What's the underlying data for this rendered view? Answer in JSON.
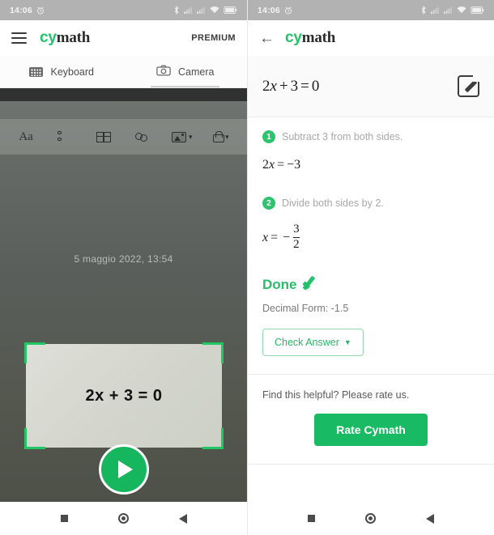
{
  "left": {
    "statusbar": {
      "time": "14:06",
      "icons": [
        "alarm-icon",
        "bluetooth-icon",
        "signal-icon",
        "signal-icon",
        "wifi-icon",
        "battery-icon"
      ]
    },
    "appbar": {
      "menu_icon": "hamburger-icon",
      "brand_cy": "cy",
      "brand_math": "math",
      "premium_label": "PREMIUM"
    },
    "tabs": [
      {
        "label": "Keyboard",
        "icon": "keyboard-icon",
        "active": false
      },
      {
        "label": "Camera",
        "icon": "camera-icon",
        "active": true
      }
    ],
    "camera": {
      "doc_toolbar": [
        "text-format-icon",
        "bullet-list-icon",
        "table-icon",
        "link-icon",
        "image-icon",
        "lock-icon"
      ],
      "date_text": "5 maggio 2022, 13:54",
      "scan_equation": "2x + 3 = 0",
      "frame_color": "#1ec862",
      "capture_label": "capture-button"
    },
    "navbar": [
      "recents-square-icon",
      "home-circle-icon",
      "back-triangle-icon"
    ]
  },
  "right": {
    "statusbar": {
      "time": "14:06",
      "icons": [
        "alarm-icon",
        "bluetooth-icon",
        "signal-icon",
        "signal-icon",
        "wifi-icon",
        "battery-icon"
      ]
    },
    "appbar": {
      "back_icon": "back-arrow-icon",
      "brand_cy": "cy",
      "brand_math": "math"
    },
    "problem": {
      "lhs_coeff": "2",
      "lhs_var": "x",
      "plus": "+",
      "lhs_const": "3",
      "equals": "=",
      "rhs": "0",
      "edit_icon": "edit-pencil-icon"
    },
    "steps": [
      {
        "number": "1",
        "text": "Subtract 3 from both sides.",
        "eq_coeff": "2",
        "eq_var": "x",
        "eq_equals": "=",
        "eq_result": "−3"
      },
      {
        "number": "2",
        "text": "Divide both sides by 2.",
        "eq_var": "x",
        "eq_equals": "=",
        "eq_minus": "−",
        "eq_numerator": "3",
        "eq_denominator": "2"
      }
    ],
    "result": {
      "done_label": "Done",
      "check_icon": "green-check-icon",
      "decimal_label": "Decimal Form: -1.5",
      "check_answer_label": "Check Answer",
      "check_answer_caret": "▼"
    },
    "rate": {
      "prompt": "Find this helpful? Please rate us.",
      "button_label": "Rate Cymath"
    },
    "navbar": [
      "recents-square-icon",
      "home-circle-icon",
      "back-triangle-icon"
    ]
  },
  "colors": {
    "brand_green": "#22c36a",
    "button_green": "#18bb63",
    "frame_green": "#1ec862",
    "statusbar_gray": "#b2b2b2"
  }
}
